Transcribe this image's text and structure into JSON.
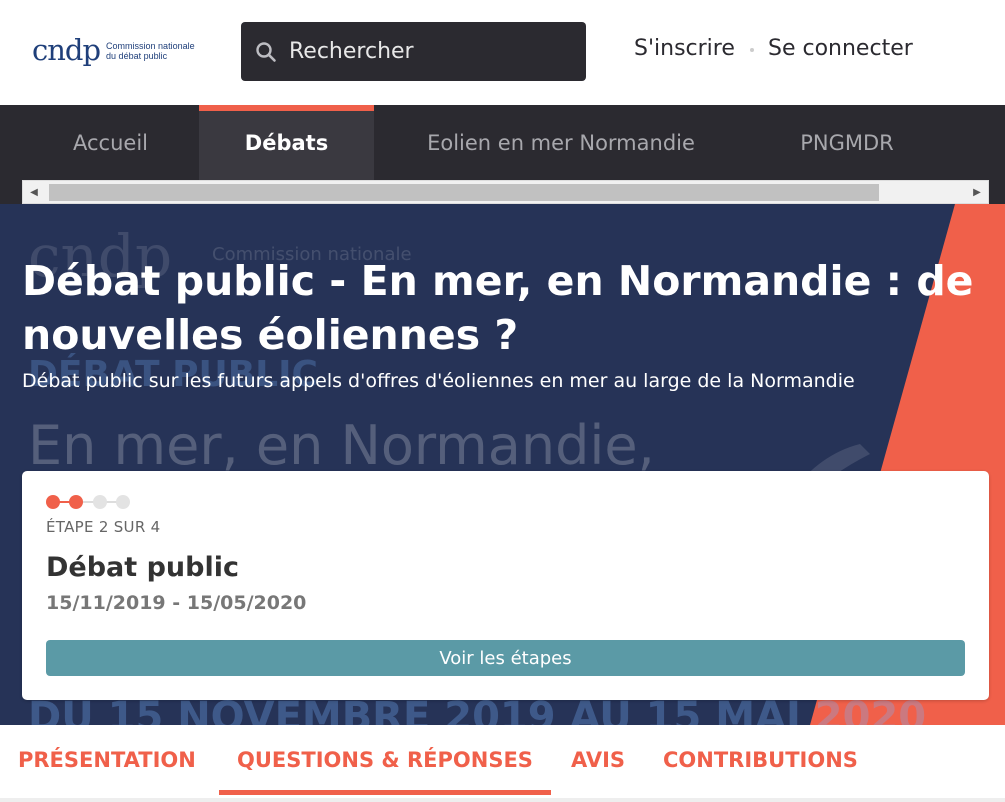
{
  "header": {
    "logo_mark": "cndp",
    "logo_line1": "Commission nationale",
    "logo_line2": "du débat public",
    "search_placeholder": "Rechercher",
    "signup_label": "S'inscrire",
    "signin_label": "Se connecter"
  },
  "nav": {
    "tabs": [
      {
        "label": "Accueil",
        "active": false
      },
      {
        "label": "Débats",
        "active": true
      },
      {
        "label": "Eolien en mer Normandie",
        "active": false
      },
      {
        "label": "PNGMDR",
        "active": false
      }
    ]
  },
  "hero": {
    "title": "Débat public - En mer, en Normandie : de nouvelles éoliennes ?",
    "subtitle": "Débat public sur les futurs appels d'offres d'éoliennes en mer au large de la Normandie",
    "bg_line1": "cndp",
    "bg_line1b": "Commission nationale",
    "bg_line2": "DÉBAT PUBLIC",
    "bg_line3": "En mer, en Normandie,",
    "bg_line4": "DU 15 NOVEMBRE 2019 AU 15 MAI 2020"
  },
  "step_card": {
    "current_step": 2,
    "total_steps": 4,
    "step_label": "ÉTAPE 2 SUR 4",
    "step_name": "Débat public",
    "step_dates": "15/11/2019 - 15/05/2020",
    "button_label": "Voir les étapes"
  },
  "tabs": [
    {
      "label": "PRÉSENTATION",
      "active": false
    },
    {
      "label": "QUESTIONS & RÉPONSES",
      "active": true
    },
    {
      "label": "AVIS",
      "active": false
    },
    {
      "label": "CONTRIBUTIONS",
      "active": false
    }
  ],
  "colors": {
    "accent": "#f0604a",
    "dark": "#2b2a30",
    "hero_bg": "#263357",
    "button": "#5b9aa6",
    "logo": "#1f3f7a"
  }
}
